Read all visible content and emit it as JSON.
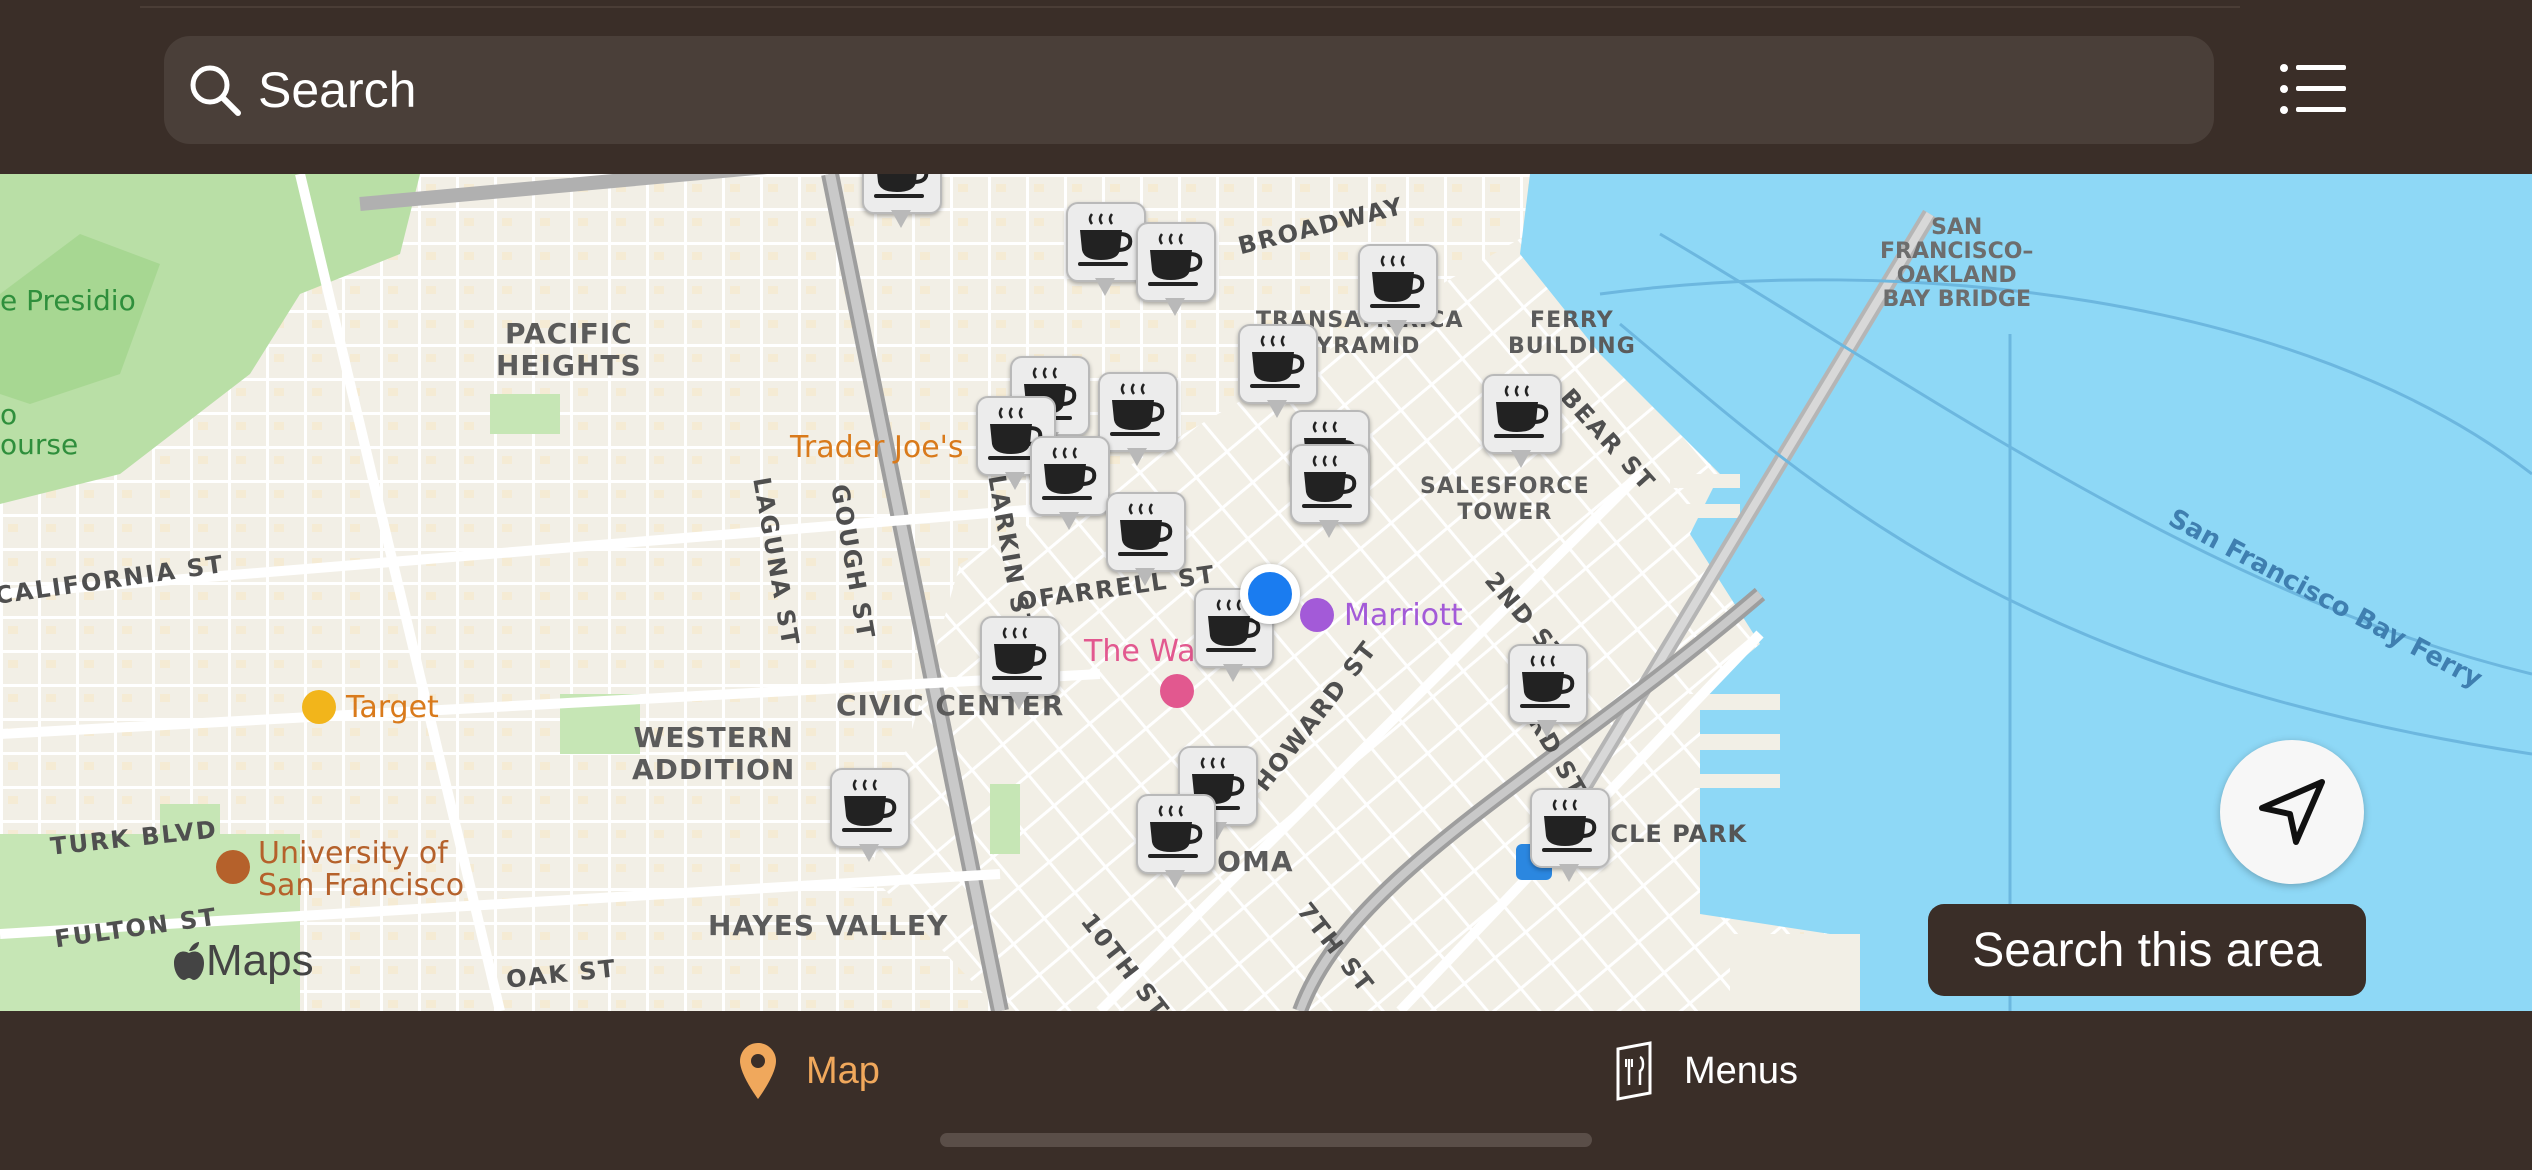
{
  "search": {
    "placeholder": "Search",
    "icon": "search-icon"
  },
  "menu_button": {
    "icon": "list-icon"
  },
  "map": {
    "districts": [
      {
        "text": "PACIFIC\nHEIGHTS"
      },
      {
        "text": "WESTERN\nADDITION"
      },
      {
        "text": "CIVIC CENTER"
      },
      {
        "text": "HAYES VALLEY"
      },
      {
        "text": "SALESFORCE\nTOWER"
      },
      {
        "text": "FERRY\nBUILDING"
      },
      {
        "text": "TRANSAMERICA\nPYRAMID"
      },
      {
        "text": "SOMA"
      }
    ],
    "streets": [
      {
        "text": "BROADWAY"
      },
      {
        "text": "CALIFORNIA ST"
      },
      {
        "text": "TURK BLVD"
      },
      {
        "text": "FULTON ST"
      },
      {
        "text": "OAK ST"
      },
      {
        "text": "LAGUNA ST"
      },
      {
        "text": "GOUGH ST"
      },
      {
        "text": "LARKIN ST"
      },
      {
        "text": "OFARRELL ST"
      },
      {
        "text": "HOWARD ST"
      },
      {
        "text": "2ND ST"
      },
      {
        "text": "3RD ST"
      },
      {
        "text": "10TH ST"
      },
      {
        "text": "7TH ST"
      },
      {
        "text": "BEAR ST"
      }
    ],
    "pois": [
      {
        "text": "Trader Joe's",
        "color": "#d97a1b"
      },
      {
        "text": "Target",
        "color": "#d97a1b"
      },
      {
        "text": "University of\nSan Francisco",
        "color": "#b5612b"
      },
      {
        "text": "Marriott",
        "color": "#a35ad8"
      },
      {
        "text": "The Wa",
        "color": "#e2588f"
      },
      {
        "text": "ORACLE PARK",
        "color": "#555555"
      },
      {
        "text": "e Presidio",
        "color": "#2f8f3c"
      },
      {
        "text": "o\nourse",
        "color": "#2f8f3c"
      }
    ],
    "water_labels": [
      {
        "text": "San Francisco Bay Ferry"
      }
    ],
    "bridge_label": "SAN\nFRANCISCO–\nOAKLAND\nBAY BRIDGE",
    "attribution": "Maps",
    "pin_icon": "coffee-cup-icon",
    "user_location_color": "#1a7cf0"
  },
  "locate_button": {
    "icon": "location-arrow-icon"
  },
  "search_area_button": {
    "label": "Search this area"
  },
  "tabs": [
    {
      "label": "Map",
      "icon": "map-pin-icon",
      "active": true,
      "color": "#f0a85c"
    },
    {
      "label": "Menus",
      "icon": "menu-card-icon",
      "active": false,
      "color": "#ffffff"
    }
  ]
}
